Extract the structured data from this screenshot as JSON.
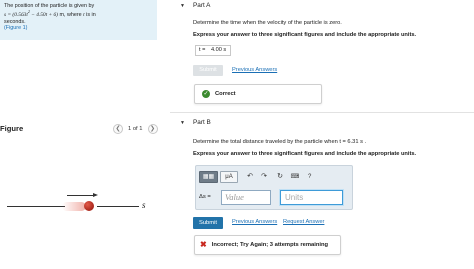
{
  "problem": {
    "line1": "The position of the particle is given by",
    "s_eq_prefix": "s = (0.563",
    "t_sq": "t",
    "sq": "2",
    "eq_mid": " − 4.50",
    "t1": "t",
    "eq_end": " + 6)",
    "unit": "m",
    "where": ", where ",
    "t2": "t",
    "is_in": " is in",
    "line3": "seconds.",
    "figure_link": "(Figure 1)"
  },
  "figure": {
    "title": "Figure",
    "pager_count": "1 of 1",
    "prev_icon": "chevron-left-icon",
    "next_icon": "chevron-right-icon",
    "axis_label": "s"
  },
  "part_a": {
    "title": "Part A",
    "question": "Determine the time when the velocity of the particle is zero.",
    "instruction": "Express your answer to three significant figures and include the appropriate units.",
    "answer_var": "t =",
    "answer_value": "4.00 s",
    "submit_label": "Submit",
    "previous_answers_label": "Previous Answers",
    "feedback": "Correct"
  },
  "part_b": {
    "title": "Part B",
    "question": "Determine the total distance traveled by the particle when t = 6.31 s .",
    "instruction": "Express your answer to three significant figures and include the appropriate units.",
    "toolbar": {
      "templates_icon": "templates-icon",
      "mu_label": "μA",
      "undo_icon": "undo-icon",
      "redo_icon": "redo-icon",
      "reset_icon": "reset-icon",
      "keyboard_icon": "keyboard-icon",
      "help_label": "?"
    },
    "delta_label": "Δs =",
    "value_placeholder": "Value",
    "units_placeholder": "Units",
    "submit_label": "Submit",
    "previous_answers_label": "Previous Answers",
    "request_answer_label": "Request Answer",
    "feedback": "Incorrect; Try Again; 3 attempts remaining"
  },
  "colors": {
    "problem_bg": "#e3f1f8",
    "link": "#1a6fb5",
    "submit": "#2273a9",
    "correct": "#3c8a2f",
    "incorrect": "#c8281f"
  }
}
